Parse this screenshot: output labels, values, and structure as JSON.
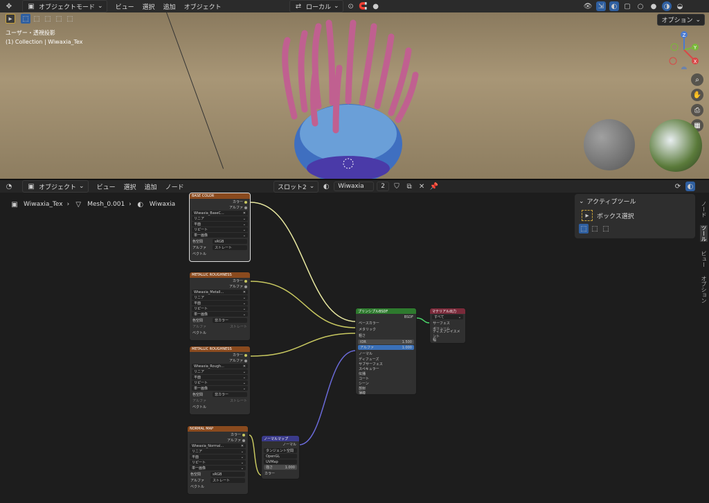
{
  "viewport_header": {
    "mode": "オブジェクトモード",
    "menus": [
      "ビュー",
      "選択",
      "追加",
      "オブジェクト"
    ],
    "transform": "ローカル",
    "options": "オプション"
  },
  "viewport": {
    "view_name": "ユーザー・透視投影",
    "collection": "(1) Collection | Wiwaxia_Tex"
  },
  "node_header": {
    "mode": "オブジェクト",
    "menus": [
      "ビュー",
      "選択",
      "追加",
      "ノード"
    ],
    "slot": "スロット2",
    "material": "Wiwaxia",
    "users": "2"
  },
  "breadcrumb": [
    "Wiwaxia_Tex",
    "Mesh_0.001",
    "Wiwaxia"
  ],
  "sidebar": {
    "title": "アクティブツール",
    "tool": "ボックス選択",
    "tabs": [
      "ノード",
      "ツール",
      "ビュー",
      "オプション"
    ]
  },
  "nodes": {
    "base_color": {
      "title": "BASE COLOR",
      "out1": "カラー",
      "out2": "アルファ",
      "image": "Wiwaxia_BaseC...",
      "interp": "リニア",
      "proj": "平面",
      "ext": "リピート",
      "frame": "単一画像",
      "cs_label": "色空間",
      "cs": "sRGB",
      "alpha_label": "アルファ",
      "alpha": "ストレート",
      "vector": "ベクトル"
    },
    "metal1": {
      "title": "METALLIC ROUGHNESS",
      "out1": "カラー",
      "out2": "アルファ",
      "image": "Wiwaxia_Metall...",
      "interp": "リニア",
      "proj": "平面",
      "ext": "リピート",
      "frame": "単一画像",
      "cs_label": "色空間",
      "cs": "非カラー",
      "alpha_label": "アルファ",
      "alpha": "ストレート",
      "vector": "ベクトル"
    },
    "metal2": {
      "title": "METALLIC ROUGHNESS",
      "out1": "カラー",
      "out2": "アルファ",
      "image": "Wiwaxia_Rough...",
      "interp": "リニア",
      "proj": "平面",
      "ext": "リピート",
      "frame": "単一画像",
      "cs_label": "色空間",
      "cs": "非カラー",
      "alpha_label": "アルファ",
      "alpha": "ストレート",
      "vector": "ベクトル"
    },
    "normal": {
      "title": "NORMAL MAP",
      "out1": "カラー",
      "out2": "アルファ",
      "image": "Wiwaxia_Normal...",
      "interp": "リニア",
      "proj": "平面",
      "ext": "リピート",
      "frame": "単一画像",
      "cs_label": "色空間",
      "cs": "sRGB",
      "alpha_label": "アルファ",
      "alpha": "ストレート",
      "vector": "ベクトル"
    },
    "normalmap": {
      "title": "ノーマルマップ",
      "out": "ノーマル",
      "space": "タンジェント空間",
      "uv": "UVMap",
      "strength_label": "強さ",
      "strength": "1.000",
      "color": "カラー",
      "gl": "OpenGL"
    },
    "bsdf": {
      "title": "プリンシプルBSDF",
      "out": "BSDF",
      "rows": [
        "ベースカラー",
        "メタリック",
        "粗さ"
      ],
      "ior_label": "IOR",
      "ior": "1.500",
      "alpha_label": "アルファ",
      "alpha": "1.000",
      "normal": "ノーマル",
      "groups": [
        "ディフューズ",
        "サブサーフェス",
        "スペキュラー",
        "伝播",
        "コート",
        "シーン",
        "放射",
        "薄膜"
      ]
    },
    "output": {
      "title": "マテリアル出力",
      "target": "すべて",
      "rows": [
        "サーフェス",
        "ボリューム",
        "ディスプレイスメント",
        "幅"
      ]
    }
  }
}
